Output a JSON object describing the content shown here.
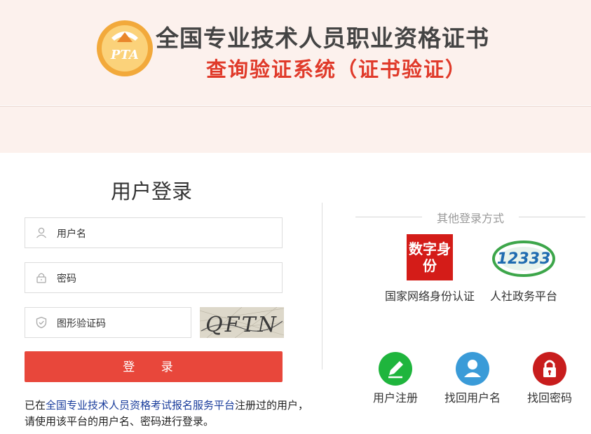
{
  "header": {
    "logo_text": "PTA",
    "title": "全国专业技术人员职业资格证书",
    "subtitle": "查询验证系统（证书验证）"
  },
  "login": {
    "title": "用户登录",
    "username_placeholder": "用户名",
    "password_placeholder": "密码",
    "captcha_placeholder": "图形验证码",
    "captcha_text": "QFTN",
    "submit_label": "登 录",
    "note_prefix": "已在",
    "note_link": "全国专业技术人员资格考试报名服务平台",
    "note_suffix": "注册过的用户，请使用该平台的用户名、密码进行登录。"
  },
  "other_login": {
    "title": "其他登录方式",
    "providers": [
      {
        "label": "国家网络身份认证",
        "icon_text": "数字身份",
        "icon": "digital-id-icon"
      },
      {
        "label": "人社政务平台",
        "icon_text": "12333",
        "icon": "12333-icon"
      }
    ]
  },
  "actions": [
    {
      "label": "用户注册",
      "icon": "pencil-icon",
      "color": "#1fb53d"
    },
    {
      "label": "找回用户名",
      "icon": "user-icon",
      "color": "#3a9bd8"
    },
    {
      "label": "找回密码",
      "icon": "lock-icon",
      "color": "#c81d1d"
    }
  ]
}
